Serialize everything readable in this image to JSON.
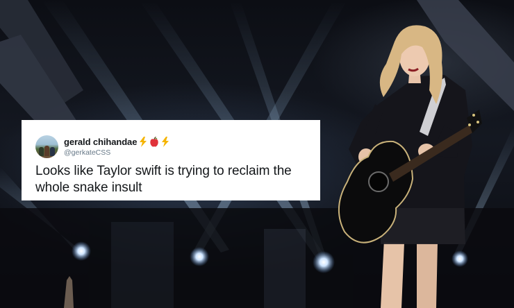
{
  "tweet": {
    "display_name": "gerald chihandae",
    "handle": "@gerkateCSS",
    "text": "Looks like Taylor swift is trying to reclaim the whole snake insult",
    "emojis": [
      "lightning-emoji",
      "apple-emoji",
      "lightning-emoji"
    ]
  },
  "photo": {
    "subject": "performer-with-acoustic-guitar",
    "colors": {
      "guitar": "#0b0b0c",
      "dress": "#14141a",
      "hair": "#d8b784",
      "skin": "#e9c7ad",
      "stage_light": "#bcd6ee"
    }
  }
}
